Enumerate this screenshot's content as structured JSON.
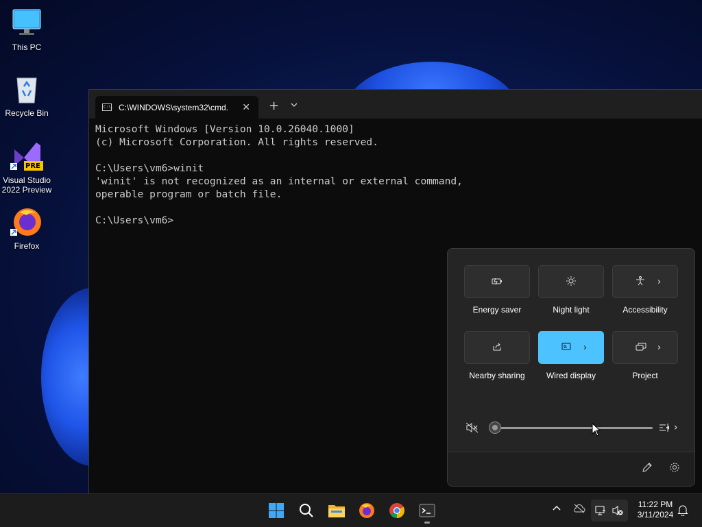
{
  "desktop": {
    "icons": [
      {
        "label": "This PC"
      },
      {
        "label": "Recycle Bin"
      },
      {
        "label": "Visual Studio 2022 Preview",
        "badge": "PRE"
      },
      {
        "label": "Firefox"
      }
    ]
  },
  "terminal": {
    "tab_title": "C:\\WINDOWS\\system32\\cmd.",
    "tab_icon_text": "C:\\.",
    "new_tab": "+",
    "dropdown": "⌄",
    "close": "✕",
    "output": "Microsoft Windows [Version 10.0.26040.1000]\n(c) Microsoft Corporation. All rights reserved.\n\nC:\\Users\\vm6>winit\n'winit' is not recognized as an internal or external command,\noperable program or batch file.\n\nC:\\Users\\vm6>"
  },
  "quick_settings": {
    "tiles": [
      {
        "label": "Energy saver",
        "icon": "energy-saver-icon",
        "active": false
      },
      {
        "label": "Night light",
        "icon": "night-light-icon",
        "active": false
      },
      {
        "label": "Accessibility",
        "icon": "accessibility-icon",
        "active": false
      },
      {
        "label": "Nearby sharing",
        "icon": "share-icon",
        "active": false
      },
      {
        "label": "Wired display",
        "icon": "cast-icon",
        "active": true
      },
      {
        "label": "Project",
        "icon": "project-icon",
        "active": false
      }
    ],
    "volume_level": 0,
    "volume_muted": true,
    "chevron": "›"
  },
  "taskbar": {
    "apps": [
      "start-icon",
      "search-icon",
      "file-explorer-icon",
      "firefox-icon",
      "chrome-icon",
      "terminal-icon"
    ],
    "tray": {
      "chevron": "^"
    },
    "clock": {
      "time": "11:22 PM",
      "date": "3/11/2024"
    }
  },
  "colors": {
    "accent": "#4cc2ff",
    "taskbar": "#1c1c1c",
    "panel": "#252525"
  }
}
